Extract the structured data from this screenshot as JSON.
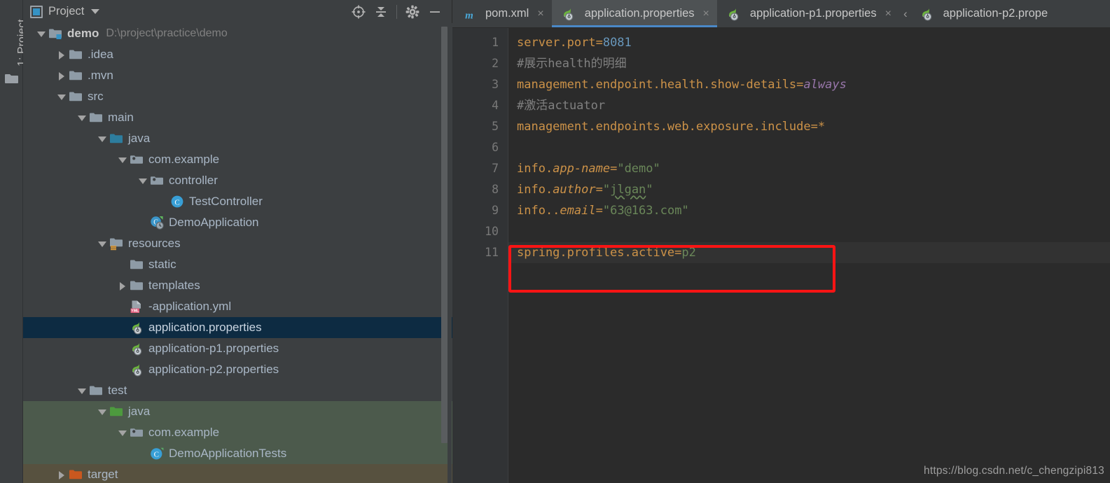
{
  "toolstrip": {
    "project_tab_prefix": "1: ",
    "project_tab_label": "Project",
    "folder_icon": "folder-icon"
  },
  "project_panel": {
    "title": "Project",
    "title_icon": "project-view-icon",
    "dropdown_icon": "chevron-down-icon",
    "actions": [
      {
        "name": "locate-in-tree-icon",
        "label": "Select Opened File"
      },
      {
        "name": "collapse-all-icon",
        "label": "Collapse All"
      },
      {
        "name": "gear-icon",
        "label": "Settings"
      },
      {
        "name": "minimize-icon",
        "label": "Hide"
      }
    ]
  },
  "tree": {
    "nodes": [
      {
        "indent": 0,
        "arrow": "down",
        "icon": "module-folder-icon",
        "label": "demo",
        "bold": true,
        "sub": "D:\\project\\practice\\demo",
        "state": "normal"
      },
      {
        "indent": 1,
        "arrow": "right",
        "icon": "folder-icon",
        "label": ".idea",
        "state": "normal"
      },
      {
        "indent": 1,
        "arrow": "right",
        "icon": "folder-icon",
        "label": ".mvn",
        "state": "normal"
      },
      {
        "indent": 1,
        "arrow": "down",
        "icon": "folder-icon",
        "label": "src",
        "state": "normal"
      },
      {
        "indent": 2,
        "arrow": "down",
        "icon": "folder-icon",
        "label": "main",
        "state": "normal"
      },
      {
        "indent": 3,
        "arrow": "down",
        "icon": "source-folder-icon",
        "label": "java",
        "state": "normal"
      },
      {
        "indent": 4,
        "arrow": "down",
        "icon": "package-icon",
        "label": "com.example",
        "state": "normal"
      },
      {
        "indent": 5,
        "arrow": "down",
        "icon": "package-icon",
        "label": "controller",
        "state": "normal"
      },
      {
        "indent": 6,
        "arrow": "none",
        "icon": "java-class-icon",
        "label": "TestController",
        "state": "normal"
      },
      {
        "indent": 5,
        "arrow": "none",
        "icon": "spring-boot-app-icon",
        "label": "DemoApplication",
        "state": "normal"
      },
      {
        "indent": 3,
        "arrow": "down",
        "icon": "resources-folder-icon",
        "label": "resources",
        "state": "normal"
      },
      {
        "indent": 4,
        "arrow": "none",
        "icon": "folder-icon",
        "label": "static",
        "state": "normal"
      },
      {
        "indent": 4,
        "arrow": "right",
        "icon": "folder-icon",
        "label": "templates",
        "state": "normal"
      },
      {
        "indent": 4,
        "arrow": "none",
        "icon": "yml-file-icon",
        "label": "-application.yml",
        "state": "normal"
      },
      {
        "indent": 4,
        "arrow": "none",
        "icon": "spring-properties-icon",
        "label": "application.properties",
        "state": "selected"
      },
      {
        "indent": 4,
        "arrow": "none",
        "icon": "spring-properties-icon",
        "label": "application-p1.properties",
        "state": "normal"
      },
      {
        "indent": 4,
        "arrow": "none",
        "icon": "spring-properties-icon",
        "label": "application-p2.properties",
        "state": "normal"
      },
      {
        "indent": 2,
        "arrow": "down",
        "icon": "folder-icon",
        "label": "test",
        "state": "normal"
      },
      {
        "indent": 3,
        "arrow": "down",
        "icon": "test-source-folder-icon",
        "label": "java",
        "state": "testsrc"
      },
      {
        "indent": 4,
        "arrow": "down",
        "icon": "package-icon",
        "label": "com.example",
        "state": "testsrc"
      },
      {
        "indent": 5,
        "arrow": "none",
        "icon": "java-test-class-icon",
        "label": "DemoApplicationTests",
        "state": "testsrc"
      },
      {
        "indent": 1,
        "arrow": "right",
        "icon": "target-folder-icon",
        "label": "target",
        "state": "targetdir"
      }
    ]
  },
  "editor": {
    "tabs": [
      {
        "label": "pom.xml",
        "icon": "maven-icon",
        "active": false,
        "closable": true
      },
      {
        "label": "application.properties",
        "icon": "spring-properties-icon",
        "active": true,
        "closable": true
      },
      {
        "label": "application-p1.properties",
        "icon": "spring-properties-icon",
        "active": false,
        "closable": true
      },
      {
        "label": "application-p2.prope",
        "icon": "spring-properties-icon",
        "active": false,
        "closable": false
      }
    ],
    "overflow_icon": "chevron-left-icon",
    "line_numbers": [
      "1",
      "2",
      "3",
      "4",
      "5",
      "6",
      "7",
      "8",
      "9",
      "10",
      "11"
    ],
    "lines": [
      {
        "n": "1",
        "text": "server.port=8081"
      },
      {
        "n": "2",
        "text": "#展示health的明细"
      },
      {
        "n": "3",
        "text": "management.endpoint.health.show-details=always"
      },
      {
        "n": "4",
        "text": "#激活actuator"
      },
      {
        "n": "5",
        "text": "management.endpoints.web.exposure.include=*"
      },
      {
        "n": "6",
        "text": ""
      },
      {
        "n": "7",
        "text": "info.app-name=\"demo\""
      },
      {
        "n": "8",
        "text": "info.author=\"jlgan\""
      },
      {
        "n": "9",
        "text": "info..email=\"63@163.com\""
      },
      {
        "n": "10",
        "text": ""
      },
      {
        "n": "11",
        "text": "spring.profiles.active=p2"
      }
    ],
    "annotation": {
      "shape": "rectangle",
      "color": "#fb1414",
      "targets_line": "11"
    }
  },
  "watermark": "https://blog.csdn.net/c_chengzipi813",
  "colors": {
    "panel_bg": "#3c3f41",
    "editor_bg": "#2b2b2b",
    "gutter_bg": "#313335",
    "selection": "#0d2b42",
    "test_source": "#4c5a4c",
    "target_dir": "#57513f",
    "tab_active": "#4e5254",
    "tab_underline": "#4a88c7",
    "key_orange": "#cc9248",
    "string_green": "#6a8759",
    "number_blue": "#6897bb",
    "value_purple": "#9876aa",
    "comment_gray": "#808080",
    "annotation_red": "#fb1414"
  }
}
